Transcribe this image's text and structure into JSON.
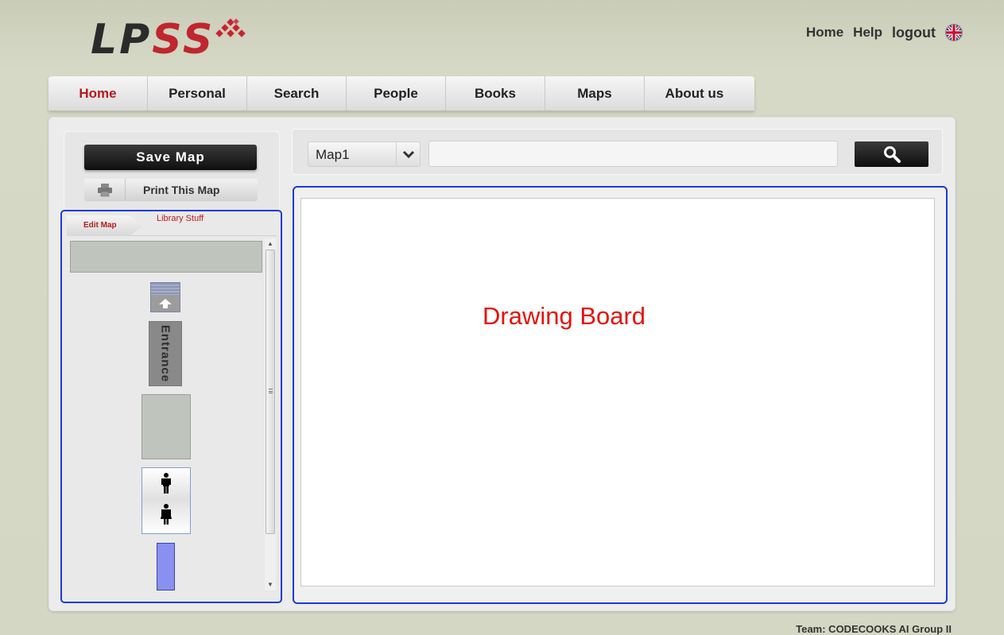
{
  "logo": {
    "text_a": "LP",
    "text_b": "SS",
    "brand_red": "#c0262d"
  },
  "top_links": {
    "home": "Home",
    "help": "Help",
    "logout": "logout",
    "language_icon": "uk-flag-icon"
  },
  "nav": {
    "items": [
      {
        "label": "Home",
        "active": true
      },
      {
        "label": "Personal"
      },
      {
        "label": "Search"
      },
      {
        "label": "People"
      },
      {
        "label": "Books"
      },
      {
        "label": "Maps"
      },
      {
        "label": "About us"
      }
    ],
    "active_color": "#b51b1b"
  },
  "left_panel": {
    "save_label": "Save Map",
    "print_label": "Print This Map",
    "tabs": {
      "edit": "Edit Map",
      "library": "Library Stuff"
    },
    "library_items": {
      "entrance_label": "Entrance"
    }
  },
  "search_bar": {
    "map_select_value": "Map1",
    "search_value": "",
    "search_icon": "magnifier-icon"
  },
  "board": {
    "label": "Drawing Board",
    "label_color": "#e4120d"
  },
  "frame_color": "#1c3cd6",
  "footer": {
    "text": "Team: CODECOOKS AI Group II"
  }
}
